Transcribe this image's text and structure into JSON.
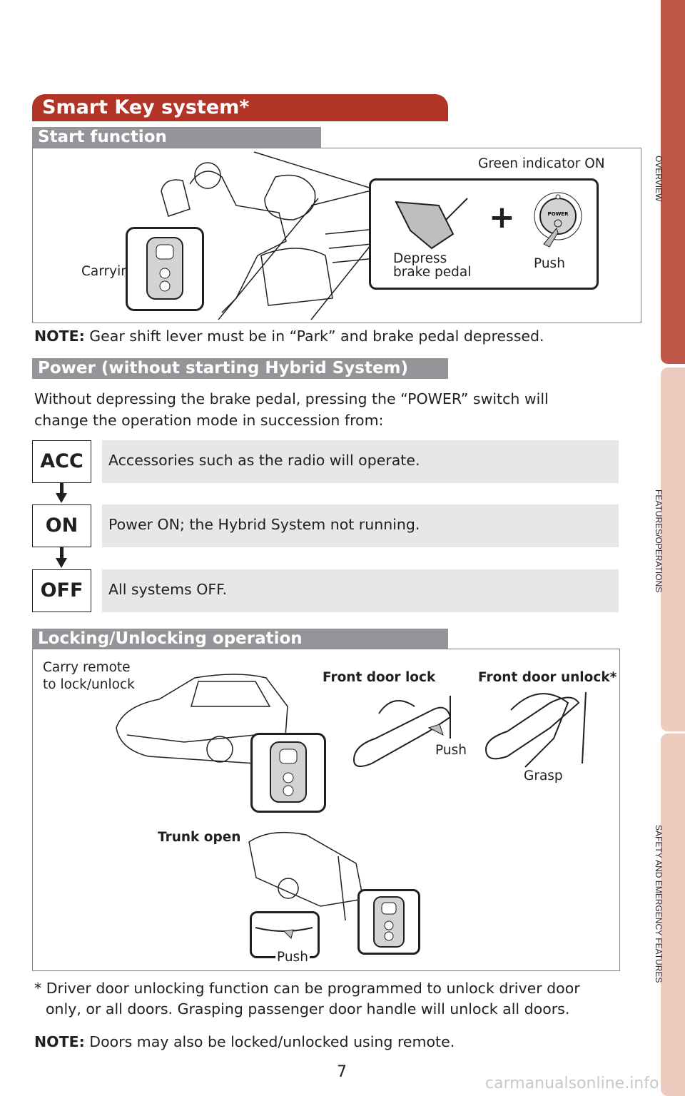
{
  "side_tabs": [
    {
      "label": "OVERVIEW",
      "color": "#c0584a",
      "active": true
    },
    {
      "label": "FEATURES/OPERATIONS",
      "color": "#eecbbf",
      "active": false
    },
    {
      "label": "SAFETY AND EMERGENCY FEATURES",
      "color": "#eecbbf",
      "active": false
    }
  ],
  "title": "Smart Key system*",
  "start_function": {
    "heading": "Start function",
    "labels": {
      "carrying": "Carrying",
      "green_indicator": "Green indicator ON",
      "depress_line1": "Depress",
      "depress_line2": "brake pedal",
      "push": "Push",
      "power_button": "POWER"
    },
    "note_label": "NOTE:",
    "note_text": " Gear shift lever must be in “Park” and brake pedal depressed."
  },
  "power": {
    "heading": "Power (without starting Hybrid System)",
    "intro_line1": "Without depressing the brake pedal, pressing the “POWER” switch will",
    "intro_line2": "change the operation mode in succession from:",
    "modes": [
      {
        "mode": "ACC",
        "description": "Accessories such as the radio will operate."
      },
      {
        "mode": "ON",
        "description": "Power ON; the Hybrid System not running."
      },
      {
        "mode": "OFF",
        "description": "All systems OFF."
      }
    ]
  },
  "locking": {
    "heading": "Locking/Unlocking operation",
    "carry_line1": "Carry remote",
    "carry_line2": "to lock/unlock",
    "front_door_lock": "Front door lock",
    "front_door_unlock": "Front door unlock*",
    "push": "Push",
    "grasp": "Grasp",
    "trunk_open": "Trunk open",
    "trunk_push": "Push"
  },
  "footnote_line1": "* Driver door unlocking function can be programmed to unlock driver door",
  "footnote_line2": "only, or all doors. Grasping passenger door handle will unlock all doors.",
  "note2_label": "NOTE:",
  "note2_text": " Doors may also be locked/unlocked using remote.",
  "page_number": "7",
  "watermark": "carmanualsonline.info",
  "colors": {
    "title_red": "#b23427",
    "subheading_gray": "#939598",
    "mode_fill": "#e6e7e8"
  }
}
